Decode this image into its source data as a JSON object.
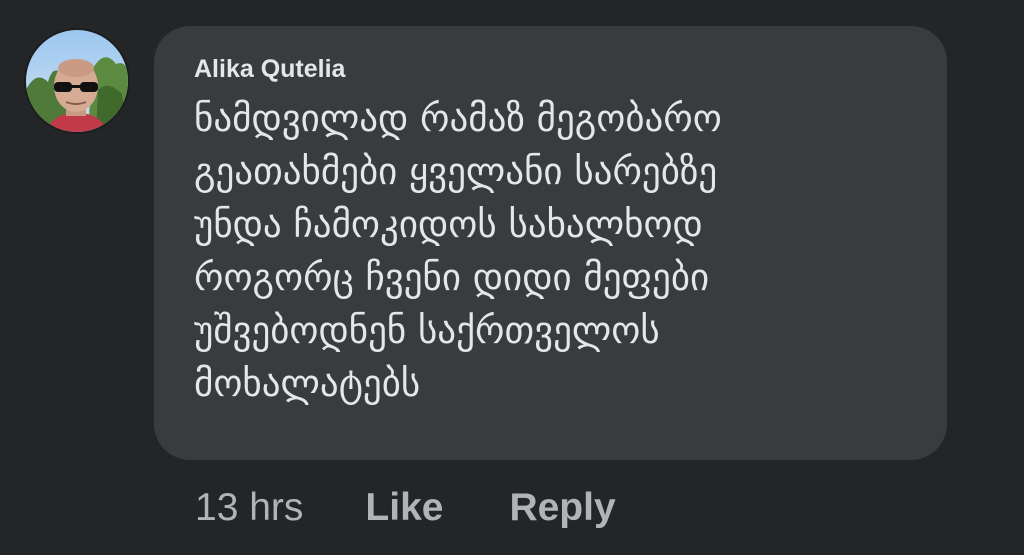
{
  "comment": {
    "avatar_icon": "user-avatar-photo",
    "author_name": "Alika Qutelia",
    "text_lines": [
      "ნამდვილად რამაზ მეგობარო",
      "გეათახმები ყველანი სარებზე",
      "უნდა ჩამოკიდოს სახალხოდ",
      "როგორც ჩვენი დიდი მეფები",
      "უშვებოდნენ საქრთველოს",
      "მოხალატებს"
    ],
    "colors": {
      "page_background": "#242526",
      "bubble_background": "#3a3b3c",
      "primary_text": "#e4e6eb",
      "secondary_text": "#b0b3b8"
    }
  },
  "actions": {
    "timestamp": "13 hrs",
    "like_label": "Like",
    "reply_label": "Reply"
  }
}
